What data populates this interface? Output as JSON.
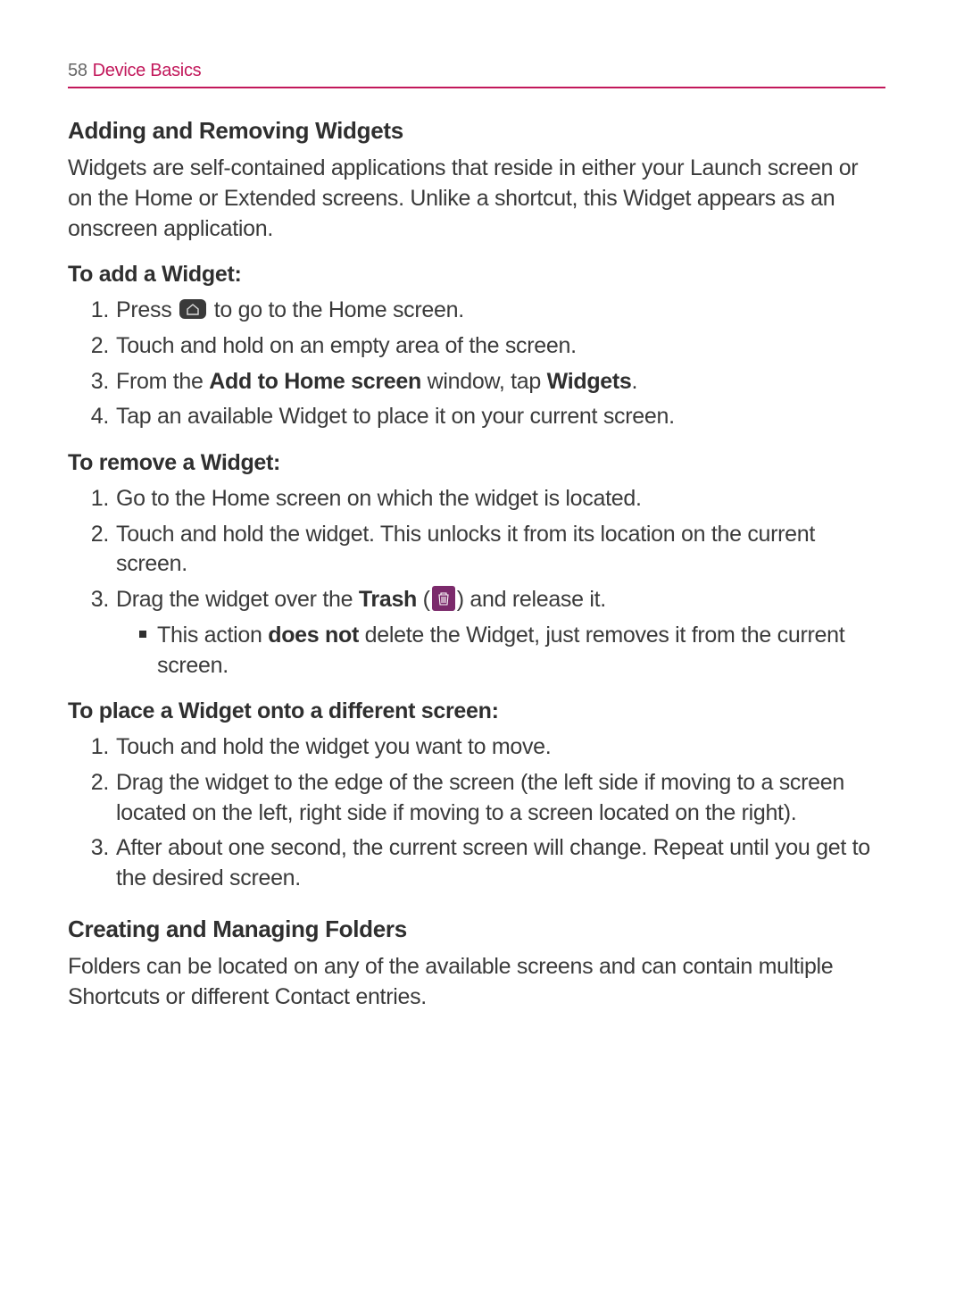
{
  "page": {
    "number": "58",
    "section": "Device Basics"
  },
  "h1": "Adding and Removing Widgets",
  "intro": "Widgets are self-contained applications that reside in either your Launch screen or on the Home or Extended screens. Unlike a shortcut, this Widget appears as an onscreen application.",
  "addWidget": {
    "heading": "To add a Widget:",
    "s1a": "Press ",
    "s1b": " to go to the Home screen.",
    "s2": "Touch and hold on an empty area of the screen.",
    "s3a": "From the ",
    "s3b": "Add to Home screen",
    "s3c": " window, tap ",
    "s3d": "Widgets",
    "s3e": ".",
    "s4": "Tap an available Widget to place it on your current screen."
  },
  "removeWidget": {
    "heading": "To remove a Widget:",
    "s1": "Go to the Home screen on which the widget is located.",
    "s2": "Touch and hold the widget. This unlocks it from its location on the current screen.",
    "s3a": "Drag the widget over the ",
    "s3b": "Trash",
    "s3c": " (",
    "s3d": ") and release it.",
    "bulletA": "This action ",
    "bulletB": "does not",
    "bulletC": " delete the Widget, just removes it from the current screen."
  },
  "placeWidget": {
    "heading": "To place a Widget onto a different screen:",
    "s1": "Touch and hold the widget you want to move.",
    "s2": "Drag the widget to the edge of the screen (the left side if moving to a screen located on the left, right side if moving to a screen located on the right).",
    "s3": "After about one second, the current screen will change. Repeat until you get to the desired screen."
  },
  "folders": {
    "heading": "Creating and Managing Folders",
    "body": "Folders can be located on any of the available screens and can contain multiple Shortcuts or different Contact entries."
  }
}
